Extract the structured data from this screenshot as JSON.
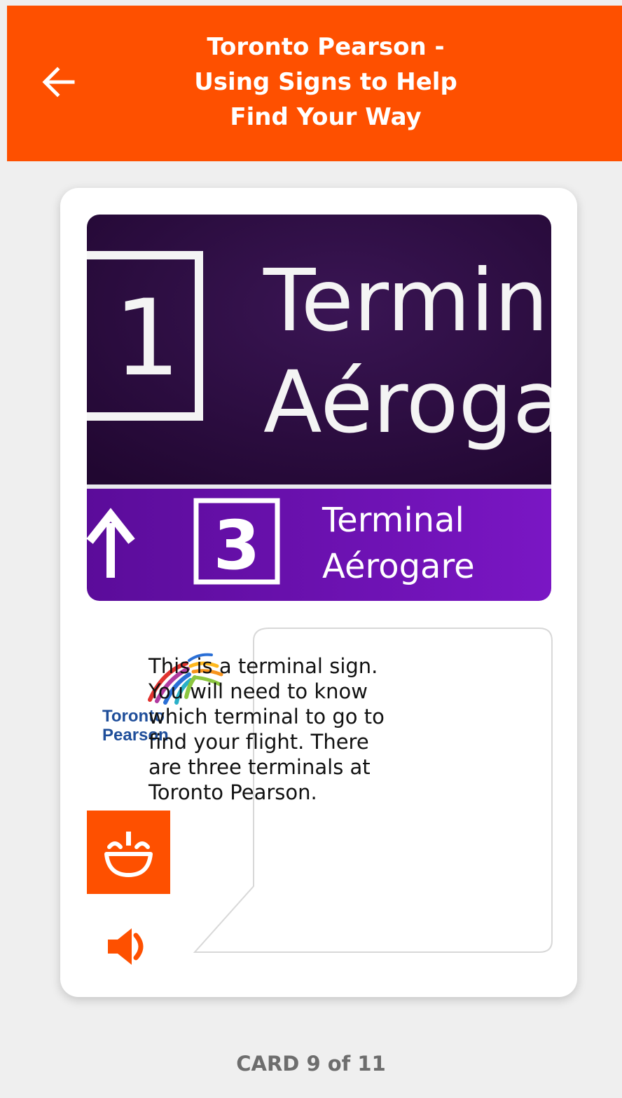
{
  "header": {
    "title_lines": [
      "Toronto Pearson -",
      "Using Signs to Help",
      "Find Your Way"
    ],
    "back_icon": "arrow-left-icon",
    "background_color": "#fe5000"
  },
  "card": {
    "image": {
      "sign_main_number": "1",
      "sign_main_line1": "Termina",
      "sign_main_line2": "Aérogar",
      "sign_sub_number": "3",
      "sign_sub_line1": "Terminal",
      "sign_sub_line2": "Aérogare",
      "sign_sub_icon": "arrow-up-icon",
      "colors": {
        "dark_purple": "#2a0a3b",
        "purple": "#6a0fb1"
      }
    },
    "logo": {
      "line1": "Toronto",
      "line2": "Pearson"
    },
    "speaker_icon": "smiling-face-icon",
    "audio_icon": "speaker-volume-icon",
    "speech_lines": [
      "This is a terminal sign.",
      "You will need to know",
      "which terminal to go to",
      "find your flight.  There",
      "are three terminals at",
      "Toronto Pearson."
    ]
  },
  "footer": {
    "counter": "CARD 9 of 11"
  }
}
